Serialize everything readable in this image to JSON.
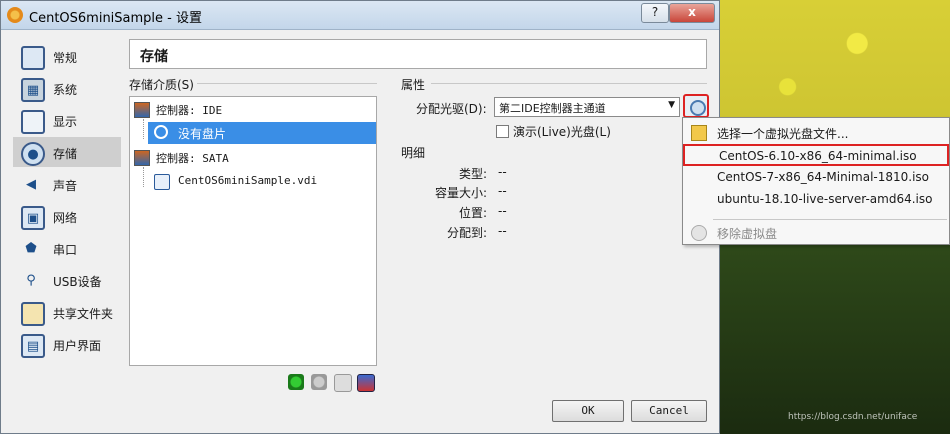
{
  "window": {
    "title": "CentOS6miniSample - 设置",
    "help": "?",
    "close": "x"
  },
  "sidebar": {
    "items": [
      {
        "label": "常规"
      },
      {
        "label": "系统"
      },
      {
        "label": "显示"
      },
      {
        "label": "存储"
      },
      {
        "label": "声音"
      },
      {
        "label": "网络"
      },
      {
        "label": "串口"
      },
      {
        "label": "USB设备"
      },
      {
        "label": "共享文件夹"
      },
      {
        "label": "用户界面"
      }
    ],
    "active": "存储"
  },
  "header": {
    "title": "存储"
  },
  "storage": {
    "label": "存储介质(S)",
    "tree": [
      {
        "label": "控制器: IDE"
      },
      {
        "label": "没有盘片"
      },
      {
        "label": "控制器: SATA"
      },
      {
        "label": "CentOS6miniSample.vdi"
      }
    ]
  },
  "properties": {
    "label": "属性",
    "drive_label": "分配光驱(D):",
    "drive_value": "第二IDE控制器主通道",
    "live_label": "演示(Live)光盘(L)",
    "live_checked": false
  },
  "info": {
    "label": "明细",
    "rows": [
      {
        "key": "类型:",
        "value": "--"
      },
      {
        "key": "容量大小:",
        "value": "--"
      },
      {
        "key": "位置:",
        "value": "--"
      },
      {
        "key": "分配到:",
        "value": "--"
      }
    ]
  },
  "buttons": {
    "ok": "OK",
    "cancel": "Cancel"
  },
  "menu": {
    "items": [
      {
        "label": "选择一个虚拟光盘文件..."
      },
      {
        "label": "CentOS-6.10-x86_64-minimal.iso"
      },
      {
        "label": "CentOS-7-x86_64-Minimal-1810.iso"
      },
      {
        "label": "ubuntu-18.10-live-server-amd64.iso"
      },
      {
        "label": "移除虚拟盘"
      }
    ],
    "highlighted": "CentOS-6.10-x86_64-minimal.iso"
  },
  "watermark": "https://blog.csdn.net/uniface"
}
